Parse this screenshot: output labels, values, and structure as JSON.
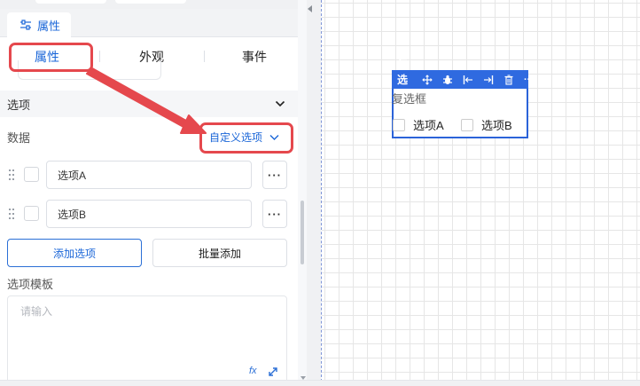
{
  "panel": {
    "tab_label": "属性",
    "subtabs": [
      "属性",
      "外观",
      "事件"
    ],
    "section_title": "选项",
    "data_label": "数据",
    "data_source_select": "自定义选项",
    "options": [
      {
        "label": "选项A",
        "more": "···"
      },
      {
        "label": "选项B",
        "more": "···"
      }
    ],
    "add_option_button": "添加选项",
    "batch_add_button": "批量添加",
    "template_label": "选项模板",
    "template_placeholder": "请输入",
    "fx_label": "fx"
  },
  "canvas": {
    "widget_toolbar_title": "复选框",
    "widget_label": "复选框",
    "widget_options": [
      "选项A",
      "选项B"
    ],
    "toolbar_more": "···"
  },
  "colors": {
    "accent": "#1a66d8",
    "highlight": "#e5484d",
    "widget_border": "#2b63d9"
  }
}
